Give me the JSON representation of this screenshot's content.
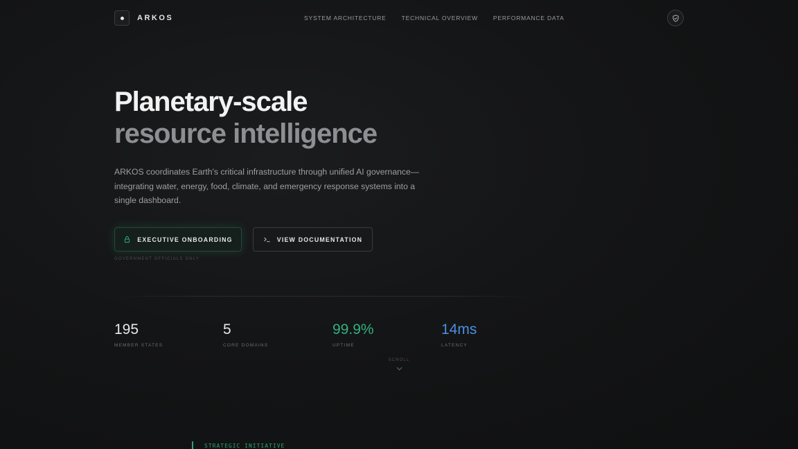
{
  "brand": {
    "name": "ARKOS"
  },
  "nav": {
    "items": [
      {
        "label": "SYSTEM ARCHITECTURE"
      },
      {
        "label": "TECHNICAL OVERVIEW"
      },
      {
        "label": "PERFORMANCE DATA"
      }
    ],
    "action_icon": "shield-check-icon"
  },
  "hero": {
    "title_line1": "Planetary-scale",
    "title_line2": "resource intelligence",
    "description": "ARKOS coordinates Earth's critical infrastructure through unified AI governance—integrating water, energy, food, climate, and emergency response systems into a single dashboard."
  },
  "cta": {
    "primary": {
      "label": "EXECUTIVE ONBOARDING",
      "icon": "lock-icon"
    },
    "secondary": {
      "label": "VIEW DOCUMENTATION",
      "icon": "terminal-icon"
    },
    "note": "GOVERNMENT OFFICIALS ONLY"
  },
  "stats": [
    {
      "value": "195",
      "label": "MEMBER STATES",
      "color": "#e8e8e8"
    },
    {
      "value": "5",
      "label": "CORE DOMAINS",
      "color": "#e8e8e8"
    },
    {
      "value": "99.9%",
      "label": "UPTIME",
      "color": "#34b07e"
    },
    {
      "value": "14ms",
      "label": "LATENCY",
      "color": "#4a8fe0"
    }
  ],
  "scroll": {
    "label": "SCROLL"
  },
  "section": {
    "label": "STRATEGIC INITIATIVE",
    "accent": "#2fa374"
  }
}
